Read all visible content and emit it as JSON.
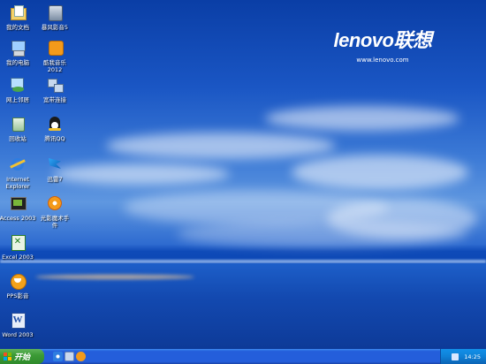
{
  "brand": {
    "logo": "lenovo联想",
    "url": "www.lenovo.com"
  },
  "icons": [
    {
      "label": "我的文档",
      "icon": "my-documents-icon"
    },
    {
      "label": "暴风影音5",
      "icon": "baofeng-player-icon"
    },
    {
      "label": "我的电脑",
      "icon": "my-computer-icon"
    },
    {
      "label": "酷我音乐\n2012",
      "icon": "kuwo-music-icon"
    },
    {
      "label": "网上邻居",
      "icon": "network-places-icon"
    },
    {
      "label": "宽带连接",
      "icon": "broadband-connection-icon"
    },
    {
      "label": "回收站",
      "icon": "recycle-bin-icon"
    },
    {
      "label": "腾讯QQ",
      "icon": "qq-icon"
    },
    {
      "label": "Internet\nExplorer",
      "icon": "internet-explorer-icon"
    },
    {
      "label": "迅雷7",
      "icon": "xunlei-icon"
    },
    {
      "label": "Access 2003",
      "icon": "access-icon"
    },
    {
      "label": "光影魔术手\n件",
      "icon": "photo-editor-icon"
    },
    {
      "label": "Excel 2003",
      "icon": "excel-icon"
    },
    {
      "label": "PPS影音",
      "icon": "pps-player-icon"
    },
    {
      "label": "Word 2003",
      "icon": "word-icon"
    }
  ],
  "taskbar": {
    "start_label": "开始",
    "quick_launch": [
      "internet-explorer-icon",
      "media-icon"
    ],
    "clock": "14:25"
  },
  "colors": {
    "taskbar": "#245edb",
    "start": "#3c9b36",
    "tray": "#0f80d6"
  }
}
